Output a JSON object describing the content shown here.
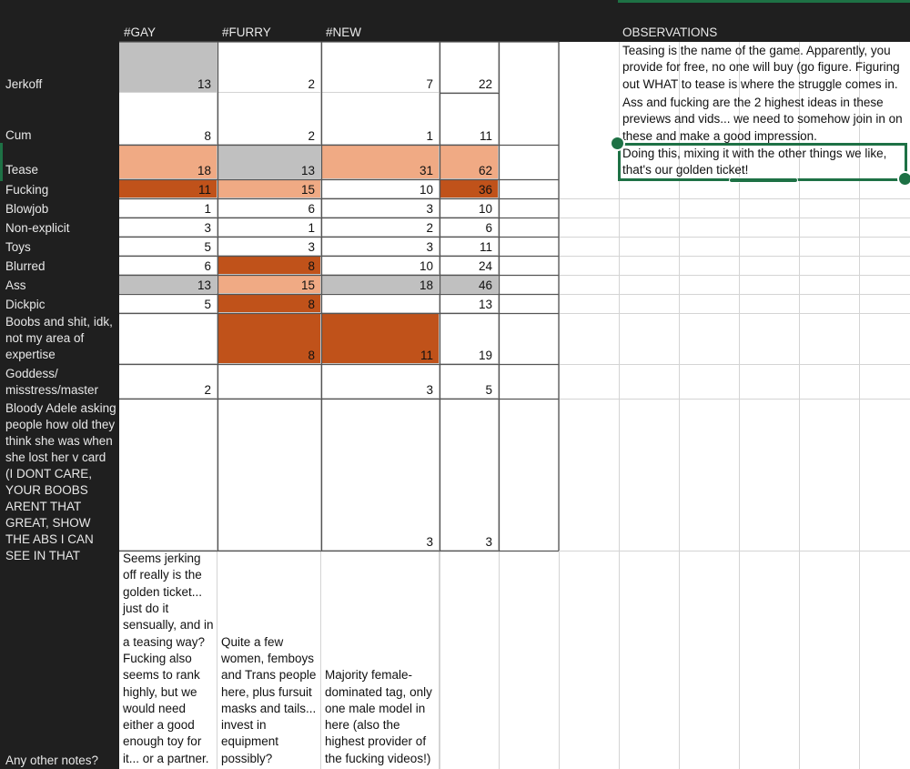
{
  "columns": {
    "gay": "#GAY",
    "furry": "#FURRY",
    "new": "#NEW",
    "observations": "OBSERVATIONS"
  },
  "rows": [
    {
      "label": "Jerkoff",
      "gay": "13",
      "furry": "2",
      "new": "7",
      "total": "22"
    },
    {
      "label": "Cum",
      "gay": "8",
      "furry": "2",
      "new": "1",
      "total": "11"
    },
    {
      "label": "Tease",
      "gay": "18",
      "furry": "13",
      "new": "31",
      "total": "62"
    },
    {
      "label": "Fucking",
      "gay": "11",
      "furry": "15",
      "new": "10",
      "total": "36"
    },
    {
      "label": "Blowjob",
      "gay": "1",
      "furry": "6",
      "new": "3",
      "total": "10"
    },
    {
      "label": "Non-explicit",
      "gay": "3",
      "furry": "1",
      "new": "2",
      "total": "6"
    },
    {
      "label": "Toys",
      "gay": "5",
      "furry": "3",
      "new": "3",
      "total": "11"
    },
    {
      "label": "Blurred",
      "gay": "6",
      "furry": "8",
      "new": "10",
      "total": "24"
    },
    {
      "label": "Ass",
      "gay": "13",
      "furry": "15",
      "new": "18",
      "total": "46"
    },
    {
      "label": "Dickpic",
      "gay": "5",
      "furry": "8",
      "new": "",
      "total": "13"
    },
    {
      "label": "Boobs and shit, idk, not my area of expertise",
      "gay": "",
      "furry": "8",
      "new": "11",
      "total": "19"
    },
    {
      "label": "Goddess/ misstress/master",
      "gay": "2",
      "furry": "",
      "new": "3",
      "total": "5"
    },
    {
      "label": "Bloody Adele asking people how old they think she was when she lost her v card (I DONT CARE, YOUR BOOBS ARENT THAT GREAT, SHOW THE ABS I CAN SEE IN THAT",
      "gay": "",
      "furry": "",
      "new": "3",
      "total": "3"
    },
    {
      "label": "Any other notes?"
    }
  ],
  "notes": {
    "gay": "Seems jerking off really is the golden ticket... just do it sensually, and in a teasing way? Fucking also seems to rank highly, but we would need either a good enough toy for it... or a partner.",
    "furry": "Quite a few women, femboys and Trans people here, plus fursuit masks and tails... invest in equipment possibly?",
    "new": "Majority female-dominated tag, only one male model in here (also the highest provider of the fucking videos!)"
  },
  "observations": {
    "p1": "Teasing is the name of the game. Apparently, you provide for free, no one will buy (go figure. Figuring out WHAT to tease is where the struggle comes in.",
    "p2": "Ass and fucking are the 2 highest ideas in these previews and vids... we need to somehow join in on these and make a good impression.",
    "p3": "Doing this, mixing it with the other things we like, that's our golden ticket!"
  },
  "colors": {
    "grey": "#c0c0c0",
    "peach": "#f0aa84",
    "burnt": "#c0521a",
    "selection": "#1e7145",
    "dark": "#1f1f1f"
  }
}
